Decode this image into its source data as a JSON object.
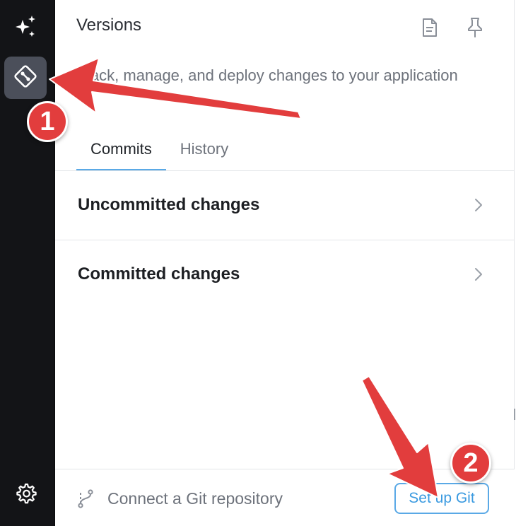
{
  "rail": {
    "items": [
      {
        "icon": "sparkle-icon"
      },
      {
        "icon": "git-versions-icon",
        "active": true
      },
      {
        "icon": "gear-icon"
      }
    ]
  },
  "header": {
    "title": "Versions",
    "icons": [
      "document-icon",
      "pin-icon"
    ]
  },
  "description": "Track, manage, and deploy changes to your application",
  "tabs": [
    {
      "label": "Commits",
      "active": true
    },
    {
      "label": "History",
      "active": false
    }
  ],
  "sections": [
    {
      "label": "Uncommitted changes"
    },
    {
      "label": "Committed changes"
    }
  ],
  "footer": {
    "connect_label": "Connect a Git repository",
    "setup_button": "Set up Git"
  },
  "annotations": {
    "badge_1": "1",
    "badge_2": "2",
    "arrow_color": "#e23d3d"
  },
  "colors": {
    "rail_bg": "#131417",
    "accent": "#5aa9e6",
    "annotation_red": "#e23d3d"
  }
}
